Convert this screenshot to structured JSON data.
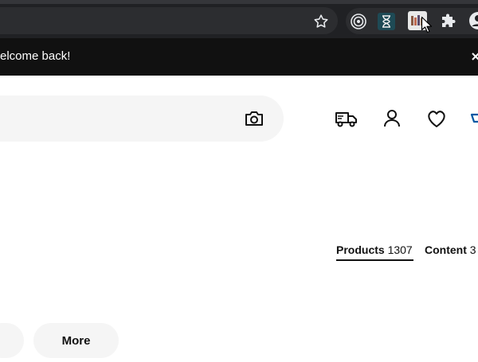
{
  "banner": {
    "message": "elcome back!",
    "close_glyph": "×"
  },
  "tabs": [
    {
      "label": "Products",
      "count": "1307"
    },
    {
      "label": "Content",
      "count": "3"
    }
  ],
  "filters": {
    "more_label": "More"
  },
  "icons": {
    "bookmark": "star-icon",
    "extensions": [
      "target-extension-icon",
      "hourglass-extension-icon",
      "image-extension-icon",
      "puzzle-icon",
      "profile-icon"
    ],
    "nav": [
      "truck-icon",
      "user-icon",
      "heart-icon",
      "cart-icon"
    ]
  },
  "colors": {
    "chrome": "#202124",
    "banner": "#111111",
    "accent": "#0058a3"
  }
}
